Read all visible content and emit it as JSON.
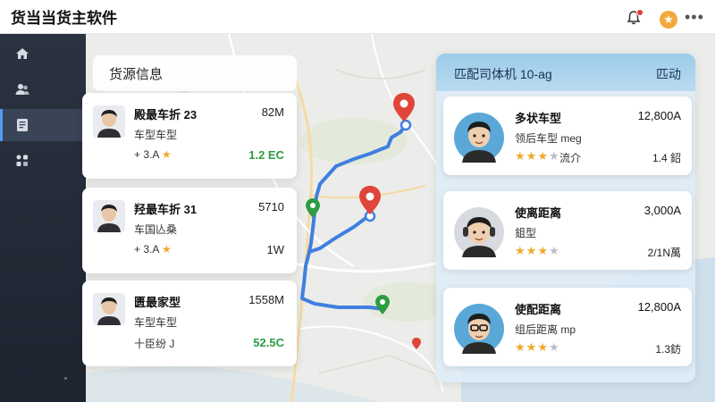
{
  "header": {
    "app_title": "货当当货主软件"
  },
  "sidebar": {
    "items": [
      {
        "icon": "home-icon"
      },
      {
        "icon": "users-icon"
      },
      {
        "icon": "document-icon"
      },
      {
        "icon": "apps-icon"
      }
    ]
  },
  "cargo_panel": {
    "title": "货源信息",
    "cards": [
      {
        "name": "殿最车折 23",
        "distance": "82M",
        "type": "车型车型",
        "rating_text": "+ 3.A",
        "price": "1.2 EC",
        "price_highlight": true
      },
      {
        "name": "羟最车折 31",
        "distance": "5710",
        "type": "车国亾桑",
        "rating_text": "+ 3.A",
        "price": "1W",
        "price_highlight": false
      },
      {
        "name": "匮最家型",
        "distance": "1558M",
        "type": "车型车型",
        "rating_text": "十臣纷 J",
        "price": "52.5C",
        "price_highlight": true
      }
    ]
  },
  "match_panel": {
    "title": "匹配司体机 10-ag",
    "action": "匹动",
    "drivers": [
      {
        "name": "多状车型",
        "value": "12,800A",
        "sub": "领后车型  meg",
        "stars": 3,
        "extra": "流介",
        "meta": "1.4  鉊"
      },
      {
        "name": "使离距离",
        "value": "3,000A",
        "sub": "鉏型",
        "stars": 3,
        "extra": "",
        "meta": "2/1N萬"
      },
      {
        "name": "使配距离",
        "value": "12,800A",
        "sub": "组后距离  mp",
        "stars": 3,
        "extra": "",
        "meta": "1.3鈁"
      }
    ]
  },
  "colors": {
    "accent": "#4f9cf0",
    "route": "#3f7fe0",
    "price_green": "#2e9c44",
    "star": "#f0a92a",
    "pin_red": "#e0453a",
    "pin_green": "#2e9c44"
  }
}
